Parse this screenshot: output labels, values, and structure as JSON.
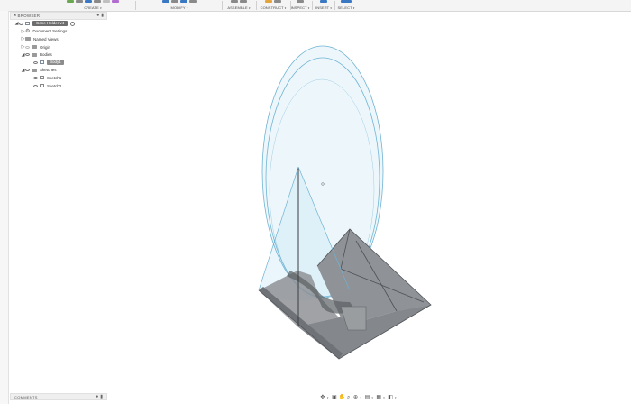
{
  "toolbar": {
    "groups": [
      {
        "label": "CREATE",
        "colors": [
          "#6aa84f",
          "#8a8a8a",
          "#3b78c4",
          "#8a8a8a",
          "#c0c0c0",
          "#b26bd1"
        ]
      },
      {
        "label": "MODIFY",
        "colors": [
          "#3b78c4",
          "#8a8a8a",
          "#3b78c4",
          "#8a8a8a"
        ]
      },
      {
        "label": "ASSEMBLE",
        "colors": [
          "#8a8a8a",
          "#8a8a8a"
        ]
      },
      {
        "label": "CONSTRUCT",
        "colors": [
          "#e5a33b",
          "#8a8a8a"
        ]
      },
      {
        "label": "INSPECT",
        "colors": [
          "#8a8a8a"
        ]
      },
      {
        "label": "INSERT",
        "colors": [
          "#3b78c4"
        ]
      },
      {
        "label": "SELECT",
        "colors": [
          "#3b78c4"
        ]
      }
    ]
  },
  "browser": {
    "title": "BROWSER",
    "root_label": "Cone Holder v4",
    "items": [
      {
        "label": "Document Settings"
      },
      {
        "label": "Named Views"
      },
      {
        "label": "Origin"
      },
      {
        "label": "Bodies"
      },
      {
        "label": "Body1"
      },
      {
        "label": "Sketches"
      },
      {
        "label": "Sketch1"
      },
      {
        "label": "Sketch2"
      }
    ]
  },
  "comments": {
    "label": "COMMENTS"
  },
  "nav": {
    "icons": [
      "orbit-icon",
      "look-at-icon",
      "pan-icon",
      "zoom-icon",
      "fit-icon",
      "display-settings-icon",
      "grid-icon",
      "viewports-icon"
    ]
  },
  "colors": {
    "glass": "#bfe3f2",
    "glass_stroke": "#6fb3d3",
    "body_dark": "#6f7378",
    "body_mid": "#8f9296",
    "body_light": "#b5b7b9"
  }
}
